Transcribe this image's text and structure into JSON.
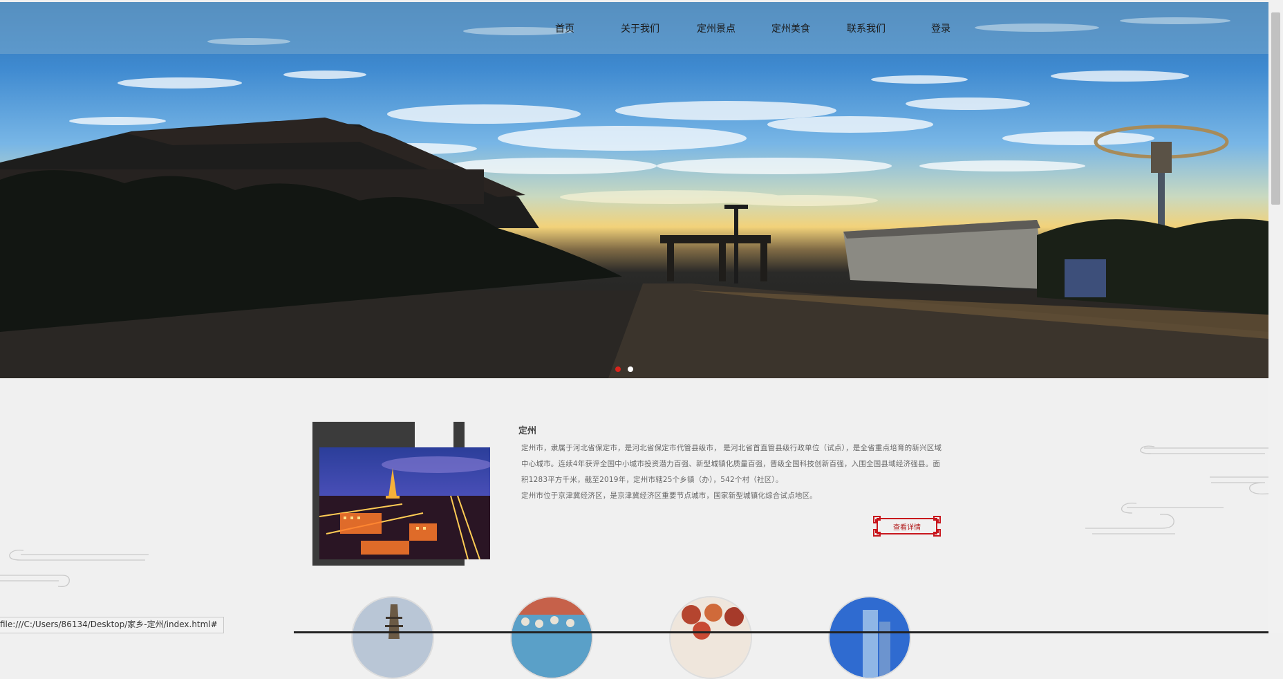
{
  "nav": {
    "items": [
      {
        "label": "首页"
      },
      {
        "label": "关于我们"
      },
      {
        "label": "定州景点"
      },
      {
        "label": "定州美食"
      },
      {
        "label": "联系我们"
      },
      {
        "label": "登录"
      }
    ]
  },
  "carousel": {
    "slide_count": 2,
    "active_index": 0,
    "active_color": "#d9241c",
    "inactive_color": "#ffffff"
  },
  "intro": {
    "title": "定州",
    "paragraphs": [
      "定州市，隶属于河北省保定市，是河北省保定市代管县级市， 是河北省首直管县级行政单位（试点），是全省重点培育的新兴区域中心城市。连续4年获评全国中小城市投资潜力百强、新型城镇化质量百强，晋级全国科技创新百强，入围全国县域经济强县。面积1283平方千米，截至2019年，定州市辖25个乡镇（办），542个村（社区）。",
      "定州市位于京津冀经济区，是京津冀经济区重要节点城市，国家新型城镇化综合试点地区。"
    ],
    "more_label": "查看详情",
    "more_color": "#c8161d"
  },
  "status_bar": {
    "url": "file:///C:/Users/86134/Desktop/家乡-定州/index.html#"
  }
}
